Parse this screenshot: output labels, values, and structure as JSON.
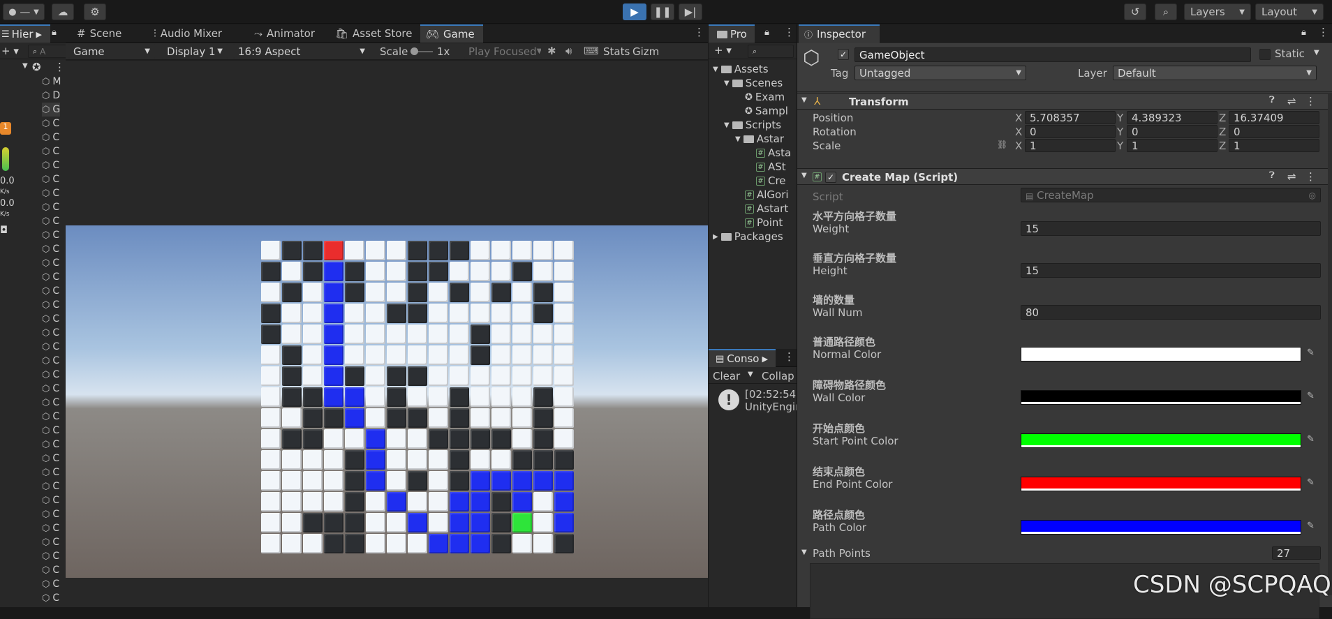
{
  "toolbar": {
    "account_label": "—",
    "play_icon": "play-icon",
    "pause_icon": "pause-icon",
    "step_icon": "step-icon",
    "layers_label": "Layers",
    "layout_label": "Layout"
  },
  "hierarchy": {
    "tab_label": "Hier",
    "search_placeholder": "A",
    "items": [
      "M",
      "D",
      "G",
      "C",
      "C",
      "C",
      "C",
      "C",
      "C",
      "C",
      "C",
      "C",
      "C",
      "C",
      "C",
      "C",
      "C",
      "C",
      "C",
      "C",
      "C",
      "C",
      "C",
      "C",
      "C",
      "C",
      "C",
      "C",
      "C",
      "C",
      "C",
      "C",
      "C",
      "C",
      "C",
      "C",
      "C",
      "C",
      "C"
    ],
    "stat1": "0.0",
    "stat1_unit": "K/s",
    "stat2": "0.0",
    "stat2_unit": "K/s"
  },
  "center_tabs": [
    "Scene",
    "Audio Mixer",
    "Animator",
    "Asset Store",
    "Game"
  ],
  "game_toolbar": {
    "view": "Game",
    "display": "Display 1",
    "aspect": "16:9 Aspect",
    "scale_label": "Scale",
    "scale_value": "1x",
    "play_mode": "Play Focused",
    "stats": "Stats",
    "gizmos": "Gizm"
  },
  "grid": {
    "size": 15,
    "colors": {
      "W": "#f2f6fa",
      "D": "#2c2f33",
      "B": "#1f2ef0",
      "R": "#ea2d2d",
      "G": "#2ee43a"
    },
    "rows": [
      "WDDRWWWDDDWWWWW",
      "DWDBDWWDDWWWDWW",
      "WDWBDWWDWDWDWDW",
      "DWWBWWDDWWWWWDW",
      "DWWBWWWWWWDWWWW",
      "WDWBWWWWWWDWWWW",
      "WDWBDWDDWWWWWWW",
      "WDDBBWDWWDWWWDW",
      "WWDDBWDDWDWWWDW",
      "WDDWWBWWDDDDWDW",
      "WWWWDBWWWDWWDDD",
      "WWWWDBWDWDBBBBB",
      "WWWWDWBWWBBDBWB",
      "WWDDDWWBWBBDGWB",
      "WWWDDWWWBBBDWWD"
    ]
  },
  "project": {
    "tab_label": "Pro",
    "tree": [
      {
        "label": "Assets",
        "indent": 0,
        "kind": "folder"
      },
      {
        "label": "Scenes",
        "indent": 1,
        "kind": "folder"
      },
      {
        "label": "Exam",
        "indent": 2,
        "kind": "scene"
      },
      {
        "label": "Sampl",
        "indent": 2,
        "kind": "scene"
      },
      {
        "label": "Scripts",
        "indent": 1,
        "kind": "folder"
      },
      {
        "label": "Astar",
        "indent": 2,
        "kind": "folder"
      },
      {
        "label": "Asta",
        "indent": 3,
        "kind": "script"
      },
      {
        "label": "ASt",
        "indent": 3,
        "kind": "script"
      },
      {
        "label": "Cre",
        "indent": 3,
        "kind": "script"
      },
      {
        "label": "AlGori",
        "indent": 2,
        "kind": "script"
      },
      {
        "label": "Astart",
        "indent": 2,
        "kind": "script"
      },
      {
        "label": "Point",
        "indent": 2,
        "kind": "script"
      },
      {
        "label": "Packages",
        "indent": 0,
        "kind": "folder"
      }
    ]
  },
  "console": {
    "tab_label": "Conso",
    "clear": "Clear",
    "collapse": "Collap",
    "log_time": "[02:52:54]",
    "log_text": "UnityEngin"
  },
  "inspector": {
    "tab_label": "Inspector",
    "object_name": "GameObject",
    "static_label": "Static",
    "tag_label": "Tag",
    "tag_value": "Untagged",
    "layer_label": "Layer",
    "layer_value": "Default",
    "transform": {
      "title": "Transform",
      "position_label": "Position",
      "rotation_label": "Rotation",
      "scale_label": "Scale",
      "position": [
        "5.708357",
        "4.389323",
        "16.37409"
      ],
      "rotation": [
        "0",
        "0",
        "0"
      ],
      "scale": [
        "1",
        "1",
        "1"
      ],
      "axis": [
        "X",
        "Y",
        "Z"
      ]
    },
    "script_component": {
      "title": "Create Map (Script)",
      "script_label": "Script",
      "script_value": "CreateMap",
      "fields": [
        {
          "header": "水平方向格子数量",
          "label": "Weight",
          "value": "15"
        },
        {
          "header": "垂直方向格子数量",
          "label": "Height",
          "value": "15"
        },
        {
          "header": "墙的数量",
          "label": "Wall Num",
          "value": "80"
        }
      ],
      "colors": [
        {
          "header": "普通路径颜色",
          "label": "Normal Color",
          "color": "#ffffff"
        },
        {
          "header": "障碍物路径颜色",
          "label": "Wall Color",
          "color": "#000000"
        },
        {
          "header": "开始点颜色",
          "label": "Start Point Color",
          "color": "#00ff00"
        },
        {
          "header": "结束点颜色",
          "label": "End Point Color",
          "color": "#ff0000"
        },
        {
          "header": "路径点颜色",
          "label": "Path Color",
          "color": "#0000ff"
        }
      ],
      "path_points_label": "Path Points",
      "path_points_count": "27"
    }
  },
  "watermark": "CSDN @SCPQAQ"
}
